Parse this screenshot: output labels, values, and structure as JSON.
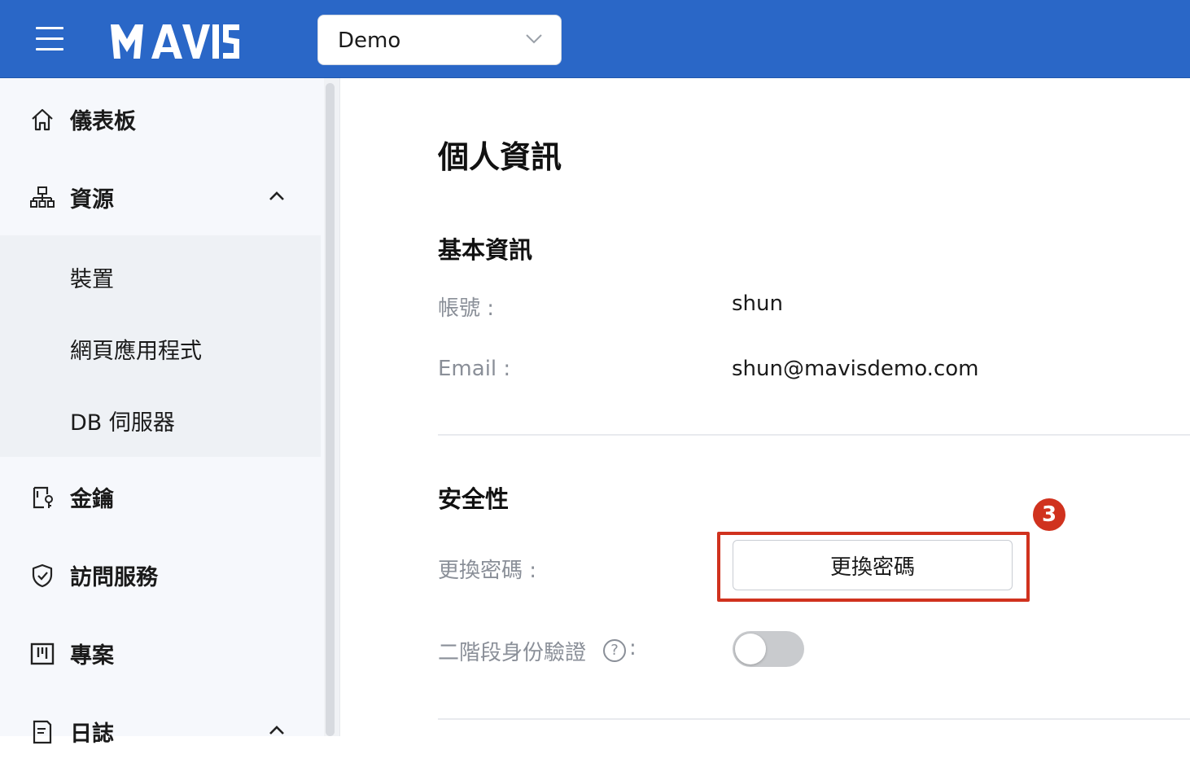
{
  "header": {
    "brand": "MAVIS",
    "org_selector": {
      "value": "Demo"
    }
  },
  "sidebar": {
    "items": [
      {
        "label": "儀表板",
        "icon": "home-icon"
      },
      {
        "label": "資源",
        "icon": "sitemap-icon",
        "expanded": true,
        "children": [
          "裝置",
          "網頁應用程式",
          "DB 伺服器"
        ]
      },
      {
        "label": "金鑰",
        "icon": "key-door-icon"
      },
      {
        "label": "訪問服務",
        "icon": "shield-check-icon"
      },
      {
        "label": "專案",
        "icon": "kanban-icon"
      },
      {
        "label": "日誌",
        "icon": "log-icon",
        "expanded": true
      }
    ]
  },
  "main": {
    "title": "個人資訊",
    "basic": {
      "heading": "基本資訊",
      "account_label": "帳號 :",
      "account_value": "shun",
      "email_label": "Email :",
      "email_value": "shun@mavisdemo.com"
    },
    "security": {
      "heading": "安全性",
      "change_pw_label": "更換密碼 :",
      "change_pw_button": "更換密碼",
      "mfa_label": "二階段身份驗證",
      "mfa_help": "?",
      "mfa_colon": ":",
      "mfa_enabled": false
    },
    "annotation": {
      "step": "3",
      "color": "#d0321e"
    }
  },
  "colors": {
    "topbar": "#2a67c7",
    "sidebar_bg": "#f6f8fc"
  }
}
